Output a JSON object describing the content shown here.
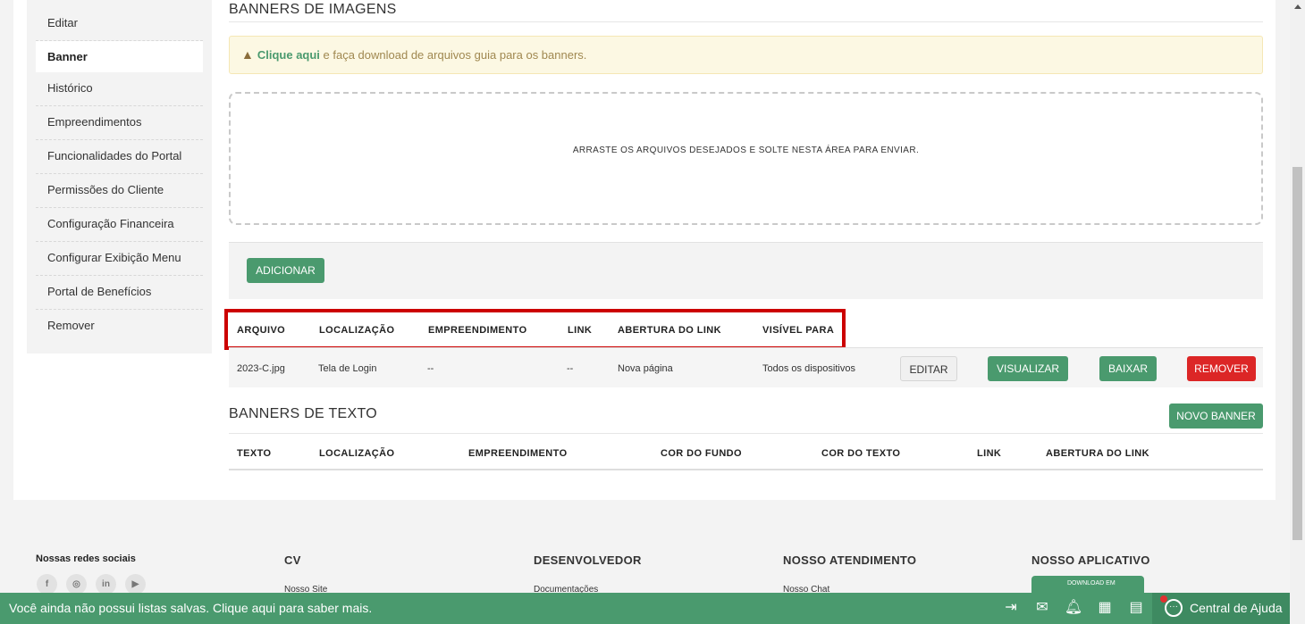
{
  "sidebar": {
    "items": [
      {
        "label": "Editar"
      },
      {
        "label": "Banner"
      },
      {
        "label": "Histórico"
      },
      {
        "label": "Empreendimentos"
      },
      {
        "label": "Funcionalidades do Portal"
      },
      {
        "label": "Permissões do Cliente"
      },
      {
        "label": "Configuração Financeira"
      },
      {
        "label": "Configurar Exibição Menu"
      },
      {
        "label": "Portal de Benefícios"
      },
      {
        "label": "Remover"
      }
    ]
  },
  "images_section": {
    "title": "BANNERS DE IMAGENS",
    "alert_link": "Clique aqui",
    "alert_text": " e faça download de arquivos guia para os banners.",
    "dropzone_text": "ARRASTE OS ARQUIVOS DESEJADOS E SOLTE NESTA ÁREA PARA ENVIAR.",
    "add_button": "ADICIONAR",
    "columns": [
      "ARQUIVO",
      "LOCALIZAÇÃO",
      "EMPREENDIMENTO",
      "LINK",
      "ABERTURA DO LINK",
      "VISÍVEL PARA"
    ],
    "rows": [
      {
        "arquivo": "2023-C.jpg",
        "localizacao": "Tela de Login",
        "empreendimento": "--",
        "link": "--",
        "abertura": "Nova página",
        "visivel": "Todos os dispositivos",
        "actions": {
          "edit": "EDITAR",
          "view": "VISUALIZAR",
          "download": "BAIXAR",
          "remove": "REMOVER"
        }
      }
    ]
  },
  "text_section": {
    "title": "BANNERS DE TEXTO",
    "new_button": "NOVO BANNER",
    "columns": [
      "TEXTO",
      "LOCALIZAÇÃO",
      "EMPREENDIMENTO",
      "COR DO FUNDO",
      "COR DO TEXTO",
      "LINK",
      "ABERTURA DO LINK"
    ]
  },
  "footer": {
    "social_title": "Nossas redes sociais",
    "social_icons": [
      "f",
      "◎",
      "in",
      "▶"
    ],
    "columns": [
      {
        "title": "CV",
        "link": "Nosso Site"
      },
      {
        "title": "DESENVOLVEDOR",
        "link": "Documentações"
      },
      {
        "title": "NOSSO ATENDIMENTO",
        "link": "Nosso Chat"
      },
      {
        "title": "NOSSO APLICATIVO",
        "link": ""
      }
    ],
    "app_badge": "DOWNLOAD EM"
  },
  "bottom_bar": {
    "message": "Você ainda não possui listas salvas. Clique aqui para saber mais.",
    "help_label": "Central de Ajuda"
  },
  "colors": {
    "accent": "#4a9a6e",
    "danger": "#dc2626",
    "highlight": "#cc0000",
    "alert_bg": "#fcf8e3"
  }
}
